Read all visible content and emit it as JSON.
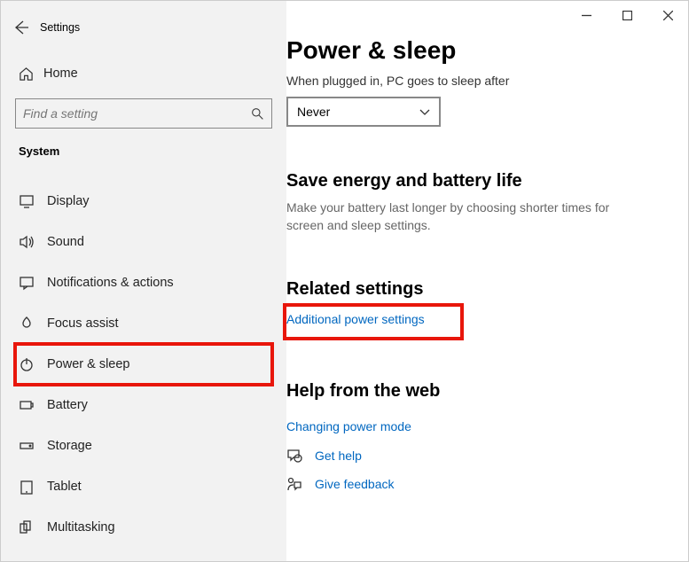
{
  "window": {
    "title": "Settings"
  },
  "sidebar": {
    "home_label": "Home",
    "search_placeholder": "Find a setting",
    "section_label": "System",
    "items": [
      {
        "label": "Display"
      },
      {
        "label": "Sound"
      },
      {
        "label": "Notifications & actions"
      },
      {
        "label": "Focus assist"
      },
      {
        "label": "Power & sleep"
      },
      {
        "label": "Battery"
      },
      {
        "label": "Storage"
      },
      {
        "label": "Tablet"
      },
      {
        "label": "Multitasking"
      }
    ]
  },
  "main": {
    "heading": "Power & sleep",
    "sleep_caption": "When plugged in, PC goes to sleep after",
    "sleep_value": "Never",
    "energy_heading": "Save energy and battery life",
    "energy_desc": "Make your battery last longer by choosing shorter times for screen and sleep settings.",
    "related_heading": "Related settings",
    "related_link": "Additional power settings",
    "help_heading": "Help from the web",
    "help_link": "Changing power mode",
    "get_help_label": "Get help",
    "feedback_label": "Give feedback"
  }
}
